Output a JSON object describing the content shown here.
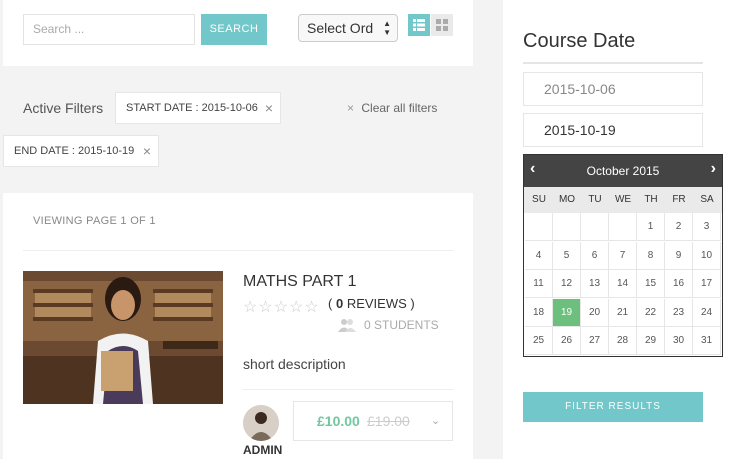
{
  "search": {
    "placeholder": "Search ...",
    "button_label": "SEARCH"
  },
  "order_select": {
    "selected": "Select Ord"
  },
  "view_modes": [
    {
      "name": "list",
      "icon": "list-icon",
      "active": true
    },
    {
      "name": "grid",
      "icon": "grid-icon",
      "active": false
    }
  ],
  "active_filters": {
    "label": "Active Filters",
    "chips": [
      {
        "text": "START DATE : 2015-10-06",
        "close": "×"
      },
      {
        "text": "END DATE : 2015-10-19",
        "close": "×"
      }
    ],
    "clear_x": "×",
    "clear_all_label": "Clear all filters"
  },
  "results": {
    "viewing_page": "VIEWING PAGE 1 OF 1",
    "course": {
      "title": "MATHS PART 1",
      "stars": "☆☆☆☆☆",
      "reviews_open": "(",
      "reviews_count": "0",
      "reviews_label": "REVIEWS )",
      "students": "0 STUDENTS",
      "short_description": "short description",
      "author": "ADMIN",
      "price": "£10.00",
      "old_price": "£19.00"
    }
  },
  "sidebar": {
    "title": "Course Date",
    "start_date": "2015-10-06",
    "end_date": "2015-10-19",
    "filter_button": "FILTER RESULTS"
  },
  "calendar": {
    "month": "October 2015",
    "prev": "‹",
    "next": "›",
    "weekdays": [
      "SU",
      "MO",
      "TU",
      "WE",
      "TH",
      "FR",
      "SA"
    ],
    "weeks": [
      [
        "",
        "",
        "",
        "",
        "1",
        "2",
        "3"
      ],
      [
        "4",
        "5",
        "6",
        "7",
        "8",
        "9",
        "10"
      ],
      [
        "11",
        "12",
        "13",
        "14",
        "15",
        "16",
        "17"
      ],
      [
        "18",
        "19",
        "20",
        "21",
        "22",
        "23",
        "24"
      ],
      [
        "25",
        "26",
        "27",
        "28",
        "29",
        "30",
        "31"
      ]
    ],
    "selected_day": "19"
  },
  "colors": {
    "accent": "#71c7c9",
    "selected_day": "#6cbf7c",
    "price": "#71c7a0",
    "calendar_header": "#444444"
  }
}
